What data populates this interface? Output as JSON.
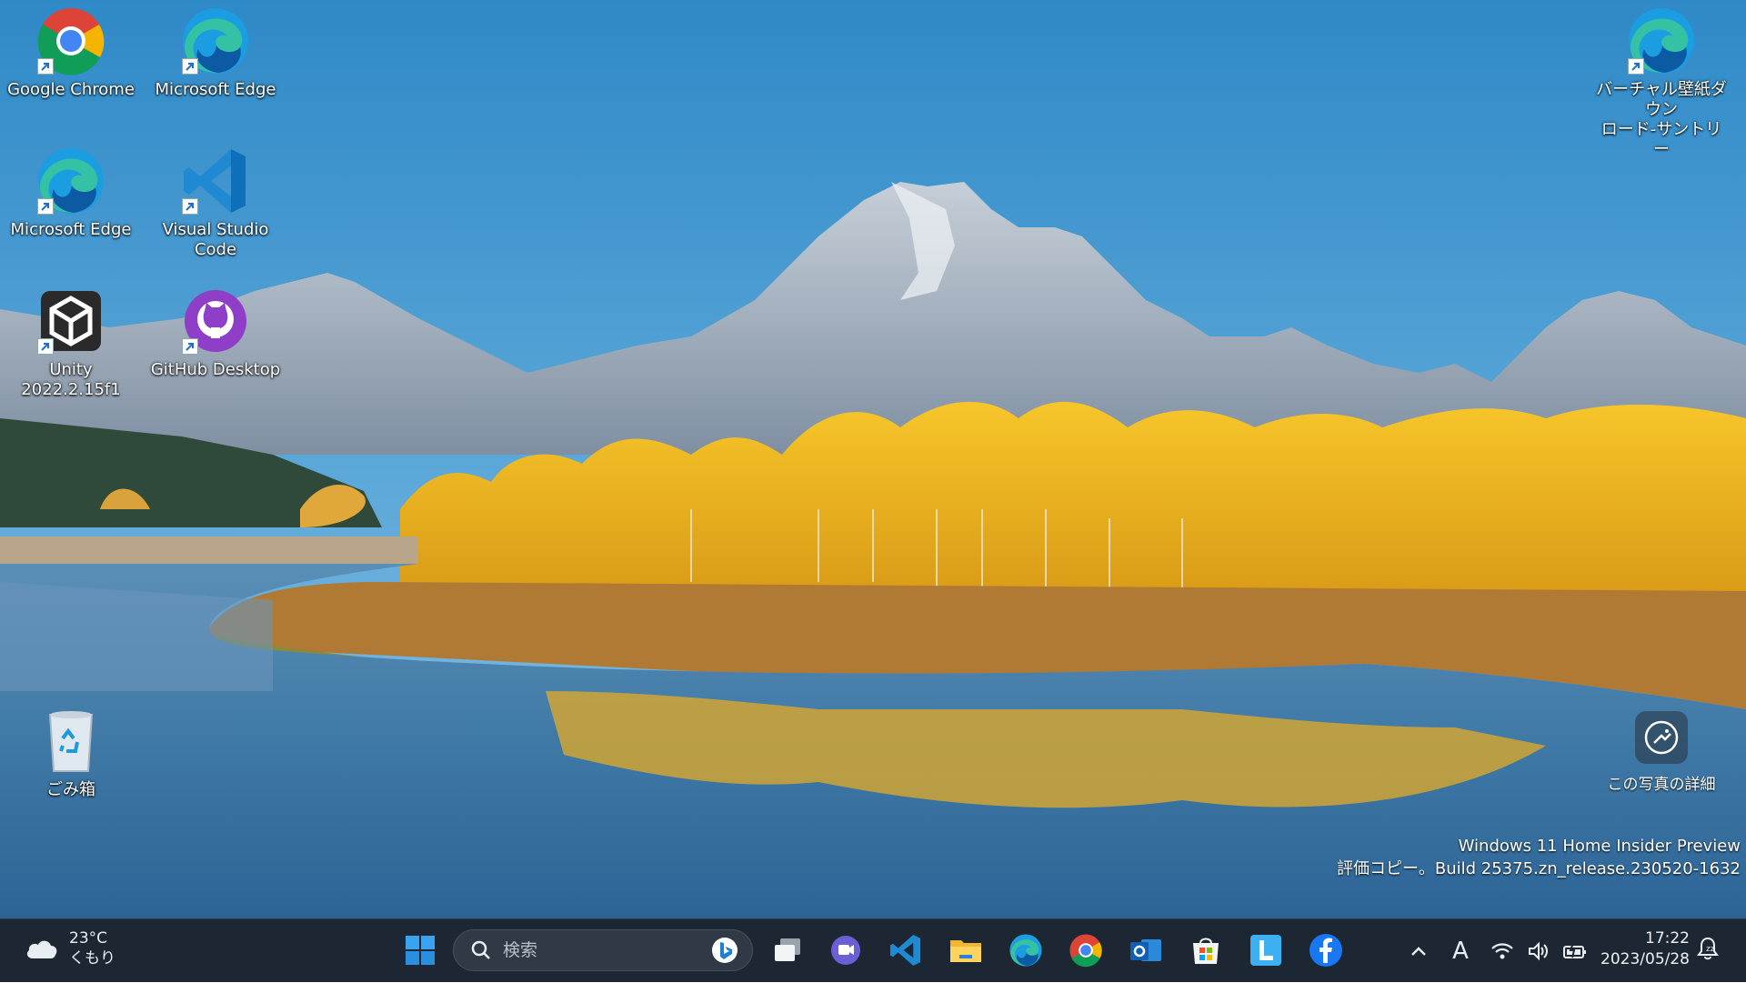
{
  "desktop": {
    "icons": [
      {
        "label": "Google Chrome",
        "icon": "chrome-icon"
      },
      {
        "label": "Microsoft Edge",
        "icon": "edge-icon"
      },
      {
        "label": "Microsoft Edge",
        "icon": "edge-icon"
      },
      {
        "label": "Visual Studio Code",
        "icon": "vscode-icon"
      },
      {
        "label": "Unity 2022.2.15f1",
        "icon": "unity-icon"
      },
      {
        "label": "GitHub Desktop",
        "icon": "github-desktop-icon"
      },
      {
        "label": "ごみ箱",
        "icon": "recycle-bin-icon"
      },
      {
        "label_line1": "バーチャル壁紙ダウン",
        "label_line2": "ロード-サントリー",
        "icon": "edge-icon"
      }
    ],
    "photo_info": {
      "label": "この写真の詳細",
      "icon": "camera-info-icon"
    },
    "watermark": {
      "line1": "Windows 11 Home Insider Preview",
      "line2": "評価コピー。Build 25375.zn_release.230520-1632"
    }
  },
  "taskbar": {
    "weather": {
      "temp": "23°C",
      "condition": "くもり",
      "icon": "cloud-icon"
    },
    "search": {
      "placeholder": "検索"
    },
    "apps": [
      "start-icon",
      "task-view-icon",
      "teams-chat-icon",
      "vscode-icon",
      "file-explorer-icon",
      "edge-icon",
      "chrome-icon",
      "outlook-icon",
      "store-icon",
      "line-icon",
      "facebook-icon"
    ],
    "tray": {
      "ime": "A",
      "icons": [
        "chevron-up-icon",
        "wifi-icon",
        "volume-icon",
        "battery-icon"
      ]
    },
    "clock": {
      "time": "17:22",
      "date": "2023/05/28"
    }
  },
  "colors": {
    "taskbar": "#1d2733",
    "sky": "#4a9bd1",
    "foliage": "#f0b81c"
  }
}
